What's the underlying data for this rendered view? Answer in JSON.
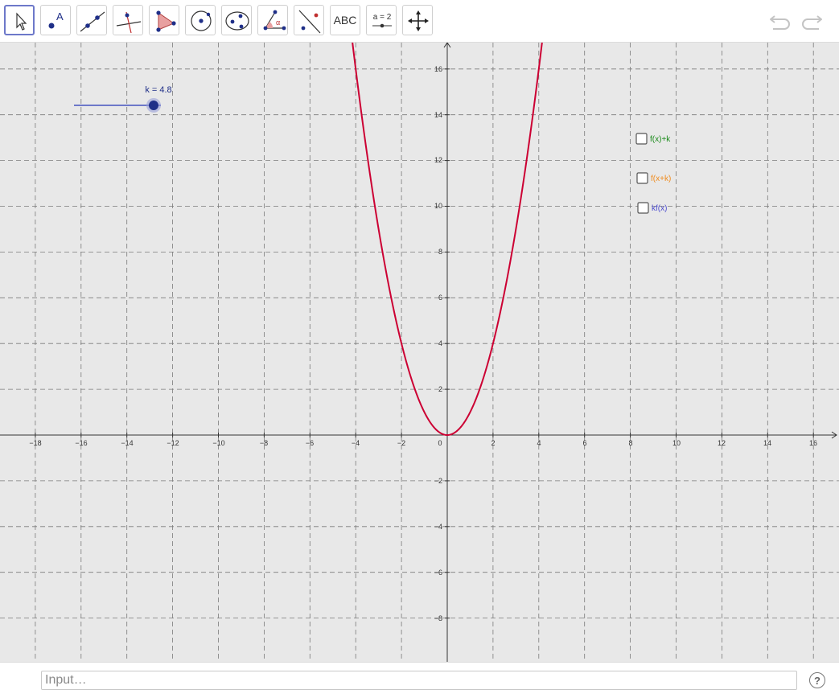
{
  "toolbar": {
    "tools": [
      {
        "name": "move-tool-button",
        "icon": "cursor-arrow-icon"
      },
      {
        "name": "point-tool-button",
        "icon": "point-icon",
        "label": "A"
      },
      {
        "name": "line-tool-button",
        "icon": "line-through-points-icon"
      },
      {
        "name": "perpendicular-tool-button",
        "icon": "perpendicular-line-icon"
      },
      {
        "name": "polygon-tool-button",
        "icon": "polygon-icon"
      },
      {
        "name": "circle-tool-button",
        "icon": "circle-center-point-icon"
      },
      {
        "name": "ellipse-tool-button",
        "icon": "ellipse-icon"
      },
      {
        "name": "angle-tool-button",
        "icon": "angle-icon",
        "label": "α"
      },
      {
        "name": "reflect-tool-button",
        "icon": "reflect-about-line-icon"
      },
      {
        "name": "text-tool-button",
        "icon": "text-icon",
        "label": "ABC"
      },
      {
        "name": "slider-tool-button",
        "icon": "slider-icon",
        "label": "a = 2"
      },
      {
        "name": "move-graphics-tool-button",
        "icon": "move-graphics-view-icon"
      }
    ],
    "undo_icon": "undo-icon",
    "redo_icon": "redo-icon"
  },
  "graphics": {
    "x_ticks": [
      "−18",
      "−16",
      "−14",
      "−12",
      "−10",
      "−8",
      "−6",
      "−4",
      "−2",
      "0",
      "2",
      "4",
      "6",
      "8",
      "10",
      "12",
      "14",
      "16"
    ],
    "y_ticks_pos": [
      "2",
      "4",
      "6",
      "8",
      "10",
      "12",
      "14",
      "16"
    ],
    "y_ticks_neg": [
      "−2",
      "−4",
      "−6",
      "−8"
    ],
    "x_range": [
      -19.5,
      17.2
    ],
    "y_range": [
      -9.9,
      17.2
    ],
    "grid": "dashed",
    "function": {
      "expression": "x^2",
      "color": "#cc0033"
    },
    "slider": {
      "label": "k = 4.8",
      "value": 4.8,
      "color": "#6d78c9"
    },
    "checkboxes": [
      {
        "label": "f(x)+k",
        "color": "#1a8a1a",
        "checked": false
      },
      {
        "label": "f(x+k)",
        "color": "#f08c1e",
        "checked": false
      },
      {
        "label": "kf(x)",
        "color": "#5050d0",
        "checked": false
      }
    ]
  },
  "input": {
    "placeholder": "Input…"
  },
  "help": {
    "label": "?"
  }
}
